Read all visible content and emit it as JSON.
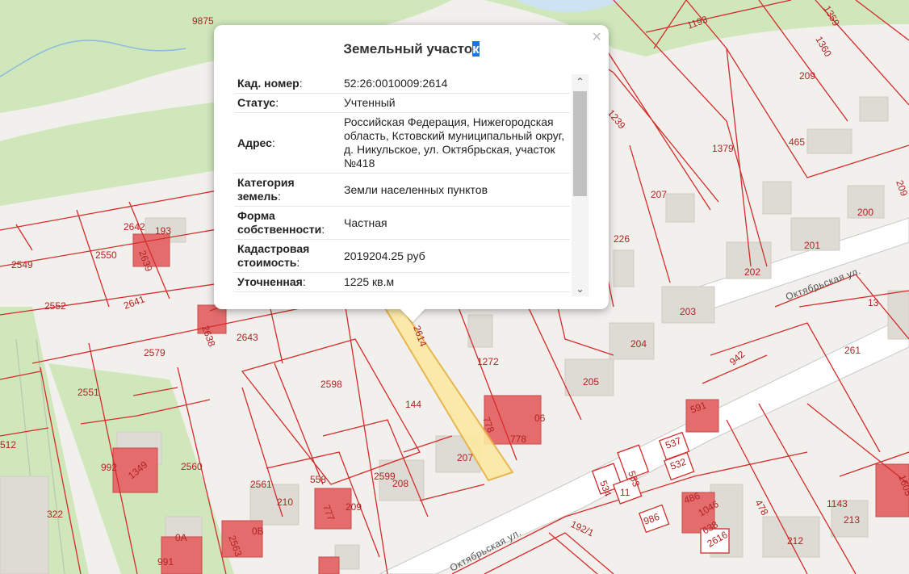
{
  "popup": {
    "title_main": "Земельный участо",
    "title_selected": "к",
    "close_glyph": "×",
    "rows": [
      {
        "key": "Кад. номер",
        "value": "52:26:0010009:2614"
      },
      {
        "key": "Статус",
        "value": "Учтенный"
      },
      {
        "key": "Адрес",
        "value": "Российская Федерация, Нижегородская область, Кстовский муниципальный округ, д. Никульское, ул. Октябрьская, участок №418"
      },
      {
        "key": "Категория земель",
        "value": "Земли населенных пунктов"
      },
      {
        "key": "Форма собственности",
        "value": "Частная"
      },
      {
        "key": "Кадастровая стоимость",
        "value": "2019204.25 руб"
      },
      {
        "key": "Уточненная",
        "value": "1225 кв.м"
      }
    ],
    "scroll_up_icon": "chevron-up-icon",
    "scroll_down_icon": "chevron-down-icon"
  },
  "map": {
    "streets": [
      "Октябрьская ул.",
      "Октябрьская ул."
    ],
    "parcels": [
      "9875",
      "1193",
      "1359",
      "1360",
      "209",
      "1239",
      "1379",
      "465",
      "209",
      "207",
      "200",
      "2642",
      "193",
      "2639",
      "2549",
      "2550",
      "226",
      "201",
      "202",
      "2552",
      "2641",
      "203",
      "13",
      "2638",
      "2643",
      "204",
      "261",
      "2579",
      "1272",
      "942",
      "2598",
      "205",
      "2551",
      "144",
      "591",
      "778",
      "778",
      "06",
      "537",
      "532",
      "1144",
      "512",
      "992",
      "2560",
      "1349",
      "533",
      "207",
      "2561",
      "558",
      "2599",
      "208",
      "534",
      "11",
      "486",
      "478",
      "1143",
      "213",
      "322",
      "210",
      "209",
      "777",
      "1046",
      "638",
      "986",
      "192/1",
      "2616",
      "212",
      "991",
      "2563",
      "0В",
      "0А",
      "2614",
      "1605"
    ],
    "colors": {
      "parcel_line": "#d42b2b",
      "highlight_fill": "#fde9a2",
      "highlight_line": "#e8b040",
      "green": "#cfe7bb",
      "road": "#ffffff",
      "building": "#dedad4",
      "red_building": "#e46c6c"
    }
  }
}
